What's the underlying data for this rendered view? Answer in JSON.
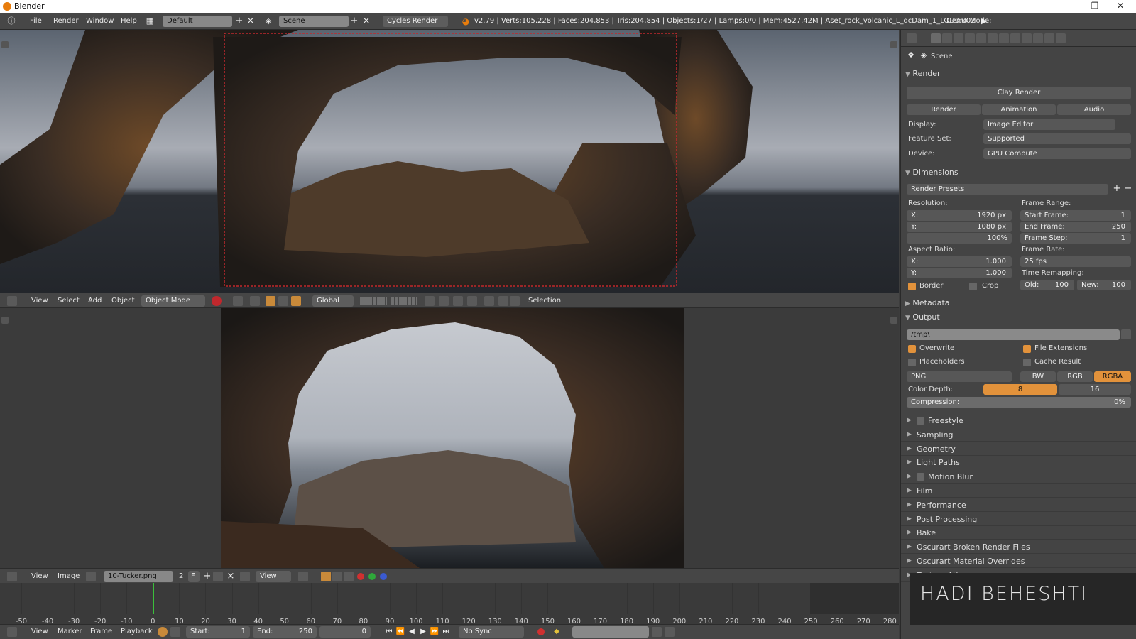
{
  "window": {
    "title": "Blender"
  },
  "menu": {
    "items": [
      "File",
      "Render",
      "Window",
      "Help"
    ]
  },
  "layout": {
    "screen": "Default",
    "scene": "Scene",
    "engine": "Cycles Render"
  },
  "stats": "v2.79 | Verts:105,228 | Faces:204,853 | Tris:204,854 | Objects:1/27 | Lamps:0/0 | Mem:4527.42M | Aset_rock_volcanic_L_qcDam_1_LOD0.002",
  "demo_mode": "Demo Mode:",
  "viewport3d": {
    "menus": [
      "View",
      "Select",
      "Add",
      "Object"
    ],
    "mode": "Object Mode",
    "orientation": "Global",
    "selection_label": "Selection"
  },
  "image_editor": {
    "menus": [
      "View",
      "Image"
    ],
    "image_name": "10-Tucker.png",
    "users": "2",
    "fake": "F",
    "view_label": "View"
  },
  "timeline": {
    "menus": [
      "View",
      "Marker",
      "Frame",
      "Playback"
    ],
    "ticks": [
      "-50",
      "-40",
      "-30",
      "-20",
      "-10",
      "0",
      "10",
      "20",
      "30",
      "40",
      "50",
      "60",
      "70",
      "80",
      "90",
      "100",
      "110",
      "120",
      "130",
      "140",
      "150",
      "160",
      "170",
      "180",
      "190",
      "200",
      "210",
      "220",
      "230",
      "240",
      "250",
      "260",
      "270",
      "280"
    ],
    "start_label": "Start:",
    "start": "1",
    "end_label": "End:",
    "end": "250",
    "current": "0",
    "sync": "No Sync"
  },
  "properties": {
    "context": "Scene",
    "render": {
      "header": "Render",
      "clay_render": "Clay Render",
      "buttons": [
        "Render",
        "Animation",
        "Audio"
      ],
      "display_label": "Display:",
      "display": "Image Editor",
      "feature_label": "Feature Set:",
      "feature": "Supported",
      "device_label": "Device:",
      "device": "GPU Compute"
    },
    "dimensions": {
      "header": "Dimensions",
      "presets": "Render Presets",
      "resolution_label": "Resolution:",
      "res_x": "1920 px",
      "res_y": "1080 px",
      "res_pct": "100%",
      "frame_range_label": "Frame Range:",
      "start_frame": "1",
      "end_frame": "250",
      "frame_step": "1",
      "start_frame_label": "Start Frame:",
      "end_frame_label": "End Frame:",
      "frame_step_label": "Frame Step:",
      "aspect_label": "Aspect Ratio:",
      "aspect_x": "1.000",
      "aspect_y": "1.000",
      "frame_rate_label": "Frame Rate:",
      "frame_rate": "25 fps",
      "time_remap_label": "Time Remapping:",
      "old_label": "Old:",
      "old": "100",
      "new_label": "New:",
      "new": "100",
      "border": "Border",
      "crop": "Crop",
      "x_label": "X:",
      "y_label": "Y:"
    },
    "metadata": "Metadata",
    "output": {
      "header": "Output",
      "path": "/tmp\\",
      "overwrite": "Overwrite",
      "file_extensions": "File Extensions",
      "placeholders": "Placeholders",
      "cache_result": "Cache Result",
      "format": "PNG",
      "modes": [
        "BW",
        "RGB",
        "RGBA"
      ],
      "color_depth_label": "Color Depth:",
      "depths": [
        "8",
        "16"
      ],
      "compression_label": "Compression:",
      "compression": "0%"
    },
    "collapsed": [
      "Freestyle",
      "Sampling",
      "Geometry",
      "Light Paths",
      "Motion Blur",
      "Film",
      "Performance",
      "Post Processing",
      "Bake",
      "Oscurart Broken Render Files",
      "Oscurart Material Overrides",
      "Texture Atlas"
    ]
  },
  "watermark": "HADI BEHESHTI",
  "colors": {
    "accent": "#e2923b",
    "selected": "#e2923b",
    "border_dash": "#c0282d"
  }
}
